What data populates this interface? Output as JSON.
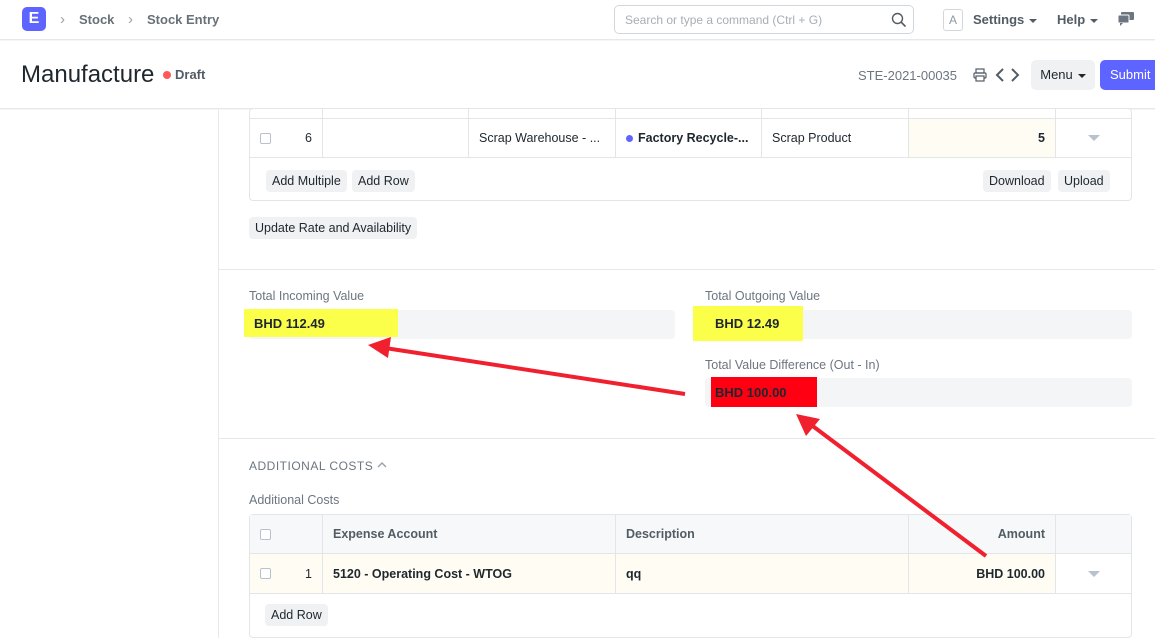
{
  "navbar": {
    "logo": "E",
    "breadcrumbs": [
      "Stock",
      "Stock Entry"
    ],
    "search_placeholder": "Search or type a command (Ctrl + G)",
    "avatar": "A",
    "settings": "Settings",
    "help": "Help"
  },
  "page": {
    "title": "Manufacture",
    "status": "Draft",
    "doc_name": "STE-2021-00035",
    "menu": "Menu",
    "submit": "Submit"
  },
  "items_table": {
    "row": {
      "idx": "6",
      "source": "",
      "target_warehouse": "Scrap Warehouse - ...",
      "item_code": "Factory Recycle-...",
      "item_name": "Scrap Product",
      "qty": "5"
    },
    "buttons": {
      "add_multiple": "Add Multiple",
      "add_row": "Add Row",
      "download": "Download",
      "upload": "Upload"
    }
  },
  "update_button": "Update Rate and Availability",
  "totals": {
    "incoming_label": "Total Incoming Value",
    "incoming_value": "BHD 112.49",
    "outgoing_label": "Total Outgoing Value",
    "outgoing_value": "BHD 12.49",
    "difference_label": "Total Value Difference (Out - In)",
    "difference_value": "BHD 100.00"
  },
  "additional_costs": {
    "section_title": "ADDITIONAL COSTS",
    "field_label": "Additional Costs",
    "columns": [
      "Expense Account",
      "Description",
      "Amount"
    ],
    "rows": [
      {
        "idx": "1",
        "expense_account": "5120 - Operating Cost - WTOG",
        "description": "qq",
        "amount": "BHD 100.00"
      }
    ],
    "add_row": "Add Row"
  },
  "colors": {
    "primary": "#5e64ff",
    "highlight_yellow": "#fbff4a",
    "highlight_red": "#ff0012",
    "annotation_arrow": "#f0202e"
  }
}
